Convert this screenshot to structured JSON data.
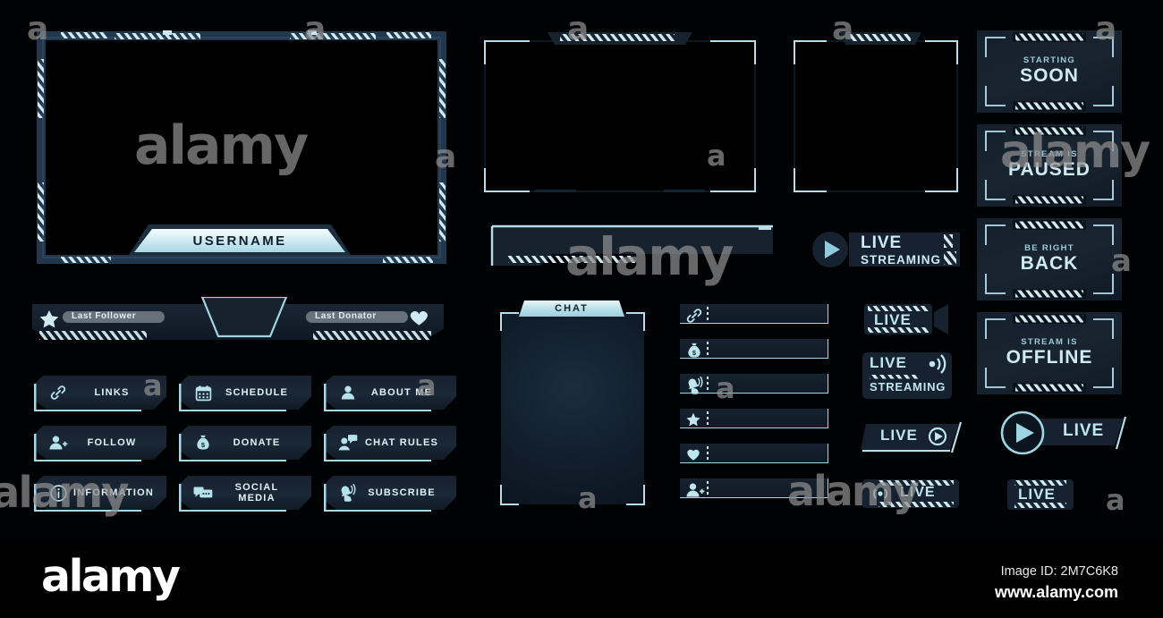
{
  "meta": {
    "watermark_text": "alamy",
    "logo": "alamy",
    "image_id_label": "Image ID: 2M7C6K8",
    "website": "www.alamy.com"
  },
  "colors": {
    "accent_cyan": "#a8d8e4",
    "text_cyan": "#cfeaf3",
    "panel_dark": "#16212f",
    "background": "#000000",
    "plate_light": "#d9eef4"
  },
  "main_frame": {
    "username_label": "USERNAME"
  },
  "webcam_frames": [
    {
      "name": "webcam-frame-wide"
    },
    {
      "name": "webcam-frame-square"
    }
  ],
  "banner": {
    "name": "lower-third-banner"
  },
  "follower_bar": {
    "follower_label": "Last Follower",
    "donator_label": "Last Donator",
    "follower_icon": "star-icon",
    "donator_icon": "heart-icon"
  },
  "buttons": [
    {
      "label": "LINKS",
      "icon": "link-icon"
    },
    {
      "label": "SCHEDULE",
      "icon": "calendar-icon"
    },
    {
      "label": "ABOUT ME",
      "icon": "user-icon"
    },
    {
      "label": "FOLLOW",
      "icon": "user-add-icon"
    },
    {
      "label": "DONATE",
      "icon": "money-bag-icon"
    },
    {
      "label": "CHAT RULES",
      "icon": "user-chat-icon"
    },
    {
      "label": "INFORMATION",
      "icon": "info-icon"
    },
    {
      "label": "SOCIAL MEDIA",
      "icon": "chat-bubble-icon"
    },
    {
      "label": "SUBSCRIBE",
      "icon": "bell-click-icon"
    }
  ],
  "chat": {
    "title": "CHAT"
  },
  "icon_rows": [
    {
      "icon": "link-icon"
    },
    {
      "icon": "money-bag-icon"
    },
    {
      "icon": "bell-click-icon"
    },
    {
      "icon": "star-icon"
    },
    {
      "icon": "heart-icon"
    },
    {
      "icon": "user-add-icon"
    }
  ],
  "status_panels": [
    {
      "top": "",
      "main": "STARTING SOON",
      "line1": "STARTING",
      "line2": "SOON"
    },
    {
      "top": "STREAM IS",
      "main": "PAUSED",
      "line1": "STREAM IS",
      "line2": "PAUSED"
    },
    {
      "top": "BE RIGHT",
      "main": "BACK",
      "line1": "BE RIGHT",
      "line2": "BACK"
    },
    {
      "top": "STREAM IS",
      "main": "OFFLINE",
      "line1": "STREAM IS",
      "line2": "OFFLINE"
    }
  ],
  "live_badges": [
    {
      "name": "live-streaming-play",
      "line1": "LIVE",
      "line2": "STREAMING",
      "icon": "play-circle-icon"
    },
    {
      "name": "live-film",
      "line1": "LIVE",
      "line2": "",
      "icon": "film-icon"
    },
    {
      "name": "live-streaming-wifi",
      "line1": "LIVE",
      "line2": "STREAMING",
      "icon": "broadcast-icon"
    },
    {
      "name": "live-play-small",
      "line1": "LIVE",
      "line2": "",
      "icon": "play-circle-icon"
    },
    {
      "name": "live-play-large",
      "line1": "LIVE",
      "line2": "",
      "icon": "play-circle-icon"
    },
    {
      "name": "live-signal",
      "line1": "LIVE",
      "line2": "",
      "icon": "broadcast-icon"
    },
    {
      "name": "live-plain",
      "line1": "LIVE",
      "line2": "",
      "icon": "none"
    }
  ]
}
